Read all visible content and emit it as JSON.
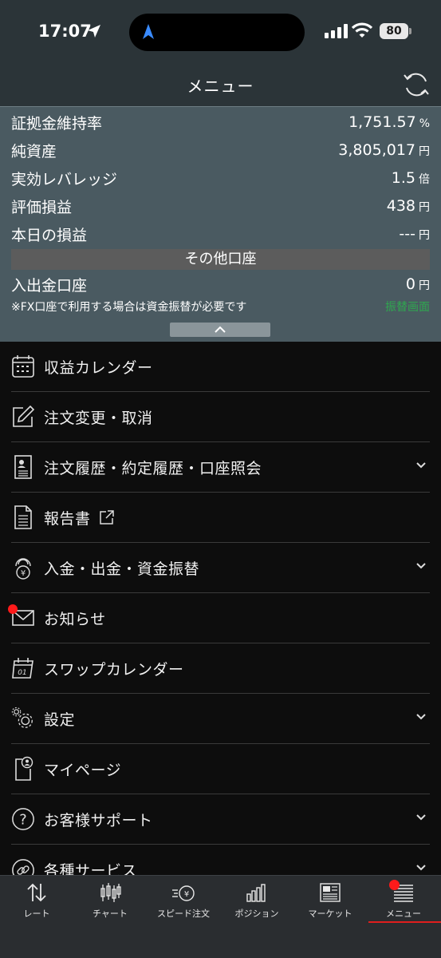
{
  "status": {
    "time": "17:07",
    "battery": "80"
  },
  "header": {
    "title": "メニュー"
  },
  "summary": {
    "rows": [
      {
        "label": "証拠金維持率",
        "value": "1,751.57",
        "unit": "%"
      },
      {
        "label": "純資産",
        "value": "3,805,017",
        "unit": "円"
      },
      {
        "label": "実効レバレッジ",
        "value": "1.5",
        "unit": "倍"
      },
      {
        "label": "評価損益",
        "value": "438",
        "unit": "円"
      },
      {
        "label": "本日の損益",
        "value": "---",
        "unit": "円"
      }
    ],
    "other_accounts_label": "その他口座",
    "deposit_row": {
      "label": "入出金口座",
      "value": "0",
      "unit": "円"
    },
    "note": "※FX口座で利用する場合は資金振替が必要です",
    "transfer_link": "振替画面"
  },
  "menu": {
    "items": [
      {
        "label": "収益カレンダー",
        "icon": "calendar-icon"
      },
      {
        "label": "注文変更・取消",
        "icon": "edit-icon"
      },
      {
        "label": "注文履歴・約定履歴・口座照会",
        "icon": "history-document-icon",
        "expandable": true
      },
      {
        "label": "報告書",
        "icon": "report-document-icon",
        "external": true
      },
      {
        "label": "入金・出金・資金振替",
        "icon": "yen-coin-icon",
        "expandable": true
      },
      {
        "label": "お知らせ",
        "icon": "envelope-icon",
        "badge": true
      },
      {
        "label": "スワップカレンダー",
        "icon": "swap-calendar-icon"
      },
      {
        "label": "設定",
        "icon": "gear-icon",
        "expandable": true
      },
      {
        "label": "マイページ",
        "icon": "mypage-icon"
      },
      {
        "label": "お客様サポート",
        "icon": "help-icon",
        "expandable": true
      },
      {
        "label": "各種サービス",
        "icon": "link-icon",
        "expandable": true
      }
    ]
  },
  "tabs": [
    {
      "label": "レート",
      "icon": "rate-arrows-icon"
    },
    {
      "label": "チャート",
      "icon": "candlestick-icon"
    },
    {
      "label": "スピード注文",
      "icon": "speed-order-icon"
    },
    {
      "label": "ポジション",
      "icon": "position-bars-icon"
    },
    {
      "label": "マーケット",
      "icon": "market-news-icon"
    },
    {
      "label": "メニュー",
      "icon": "menu-list-icon",
      "active": true
    }
  ],
  "colors": {
    "accent_red": "#e01e1e",
    "link_green": "#2fa84f",
    "panel": "#4a5a61"
  }
}
